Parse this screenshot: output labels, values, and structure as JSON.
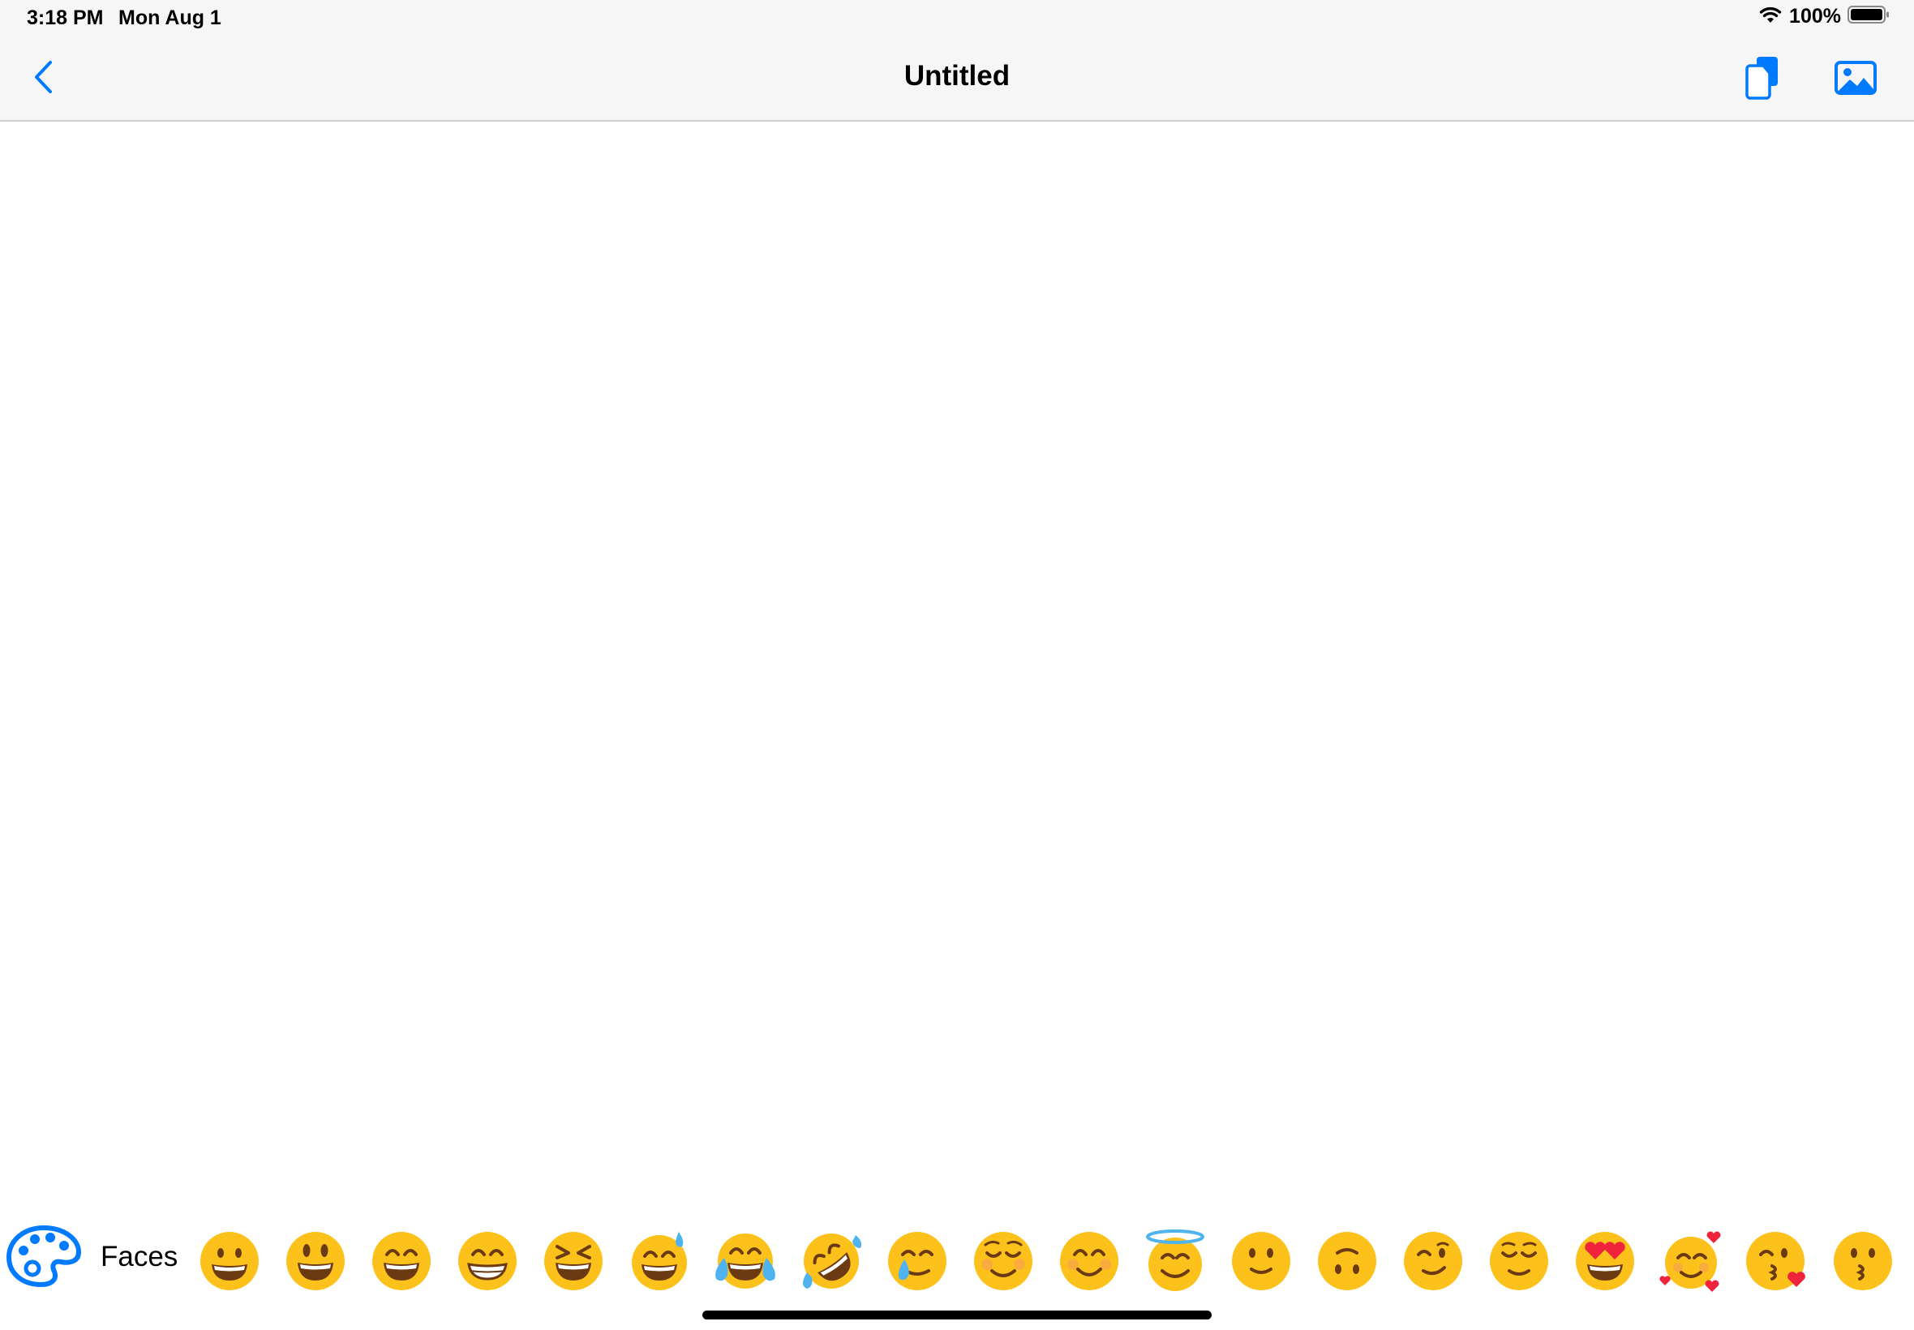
{
  "status_bar": {
    "time": "3:18 PM",
    "date": "Mon Aug 1",
    "battery_percent": "100%",
    "battery_level": 1.0,
    "icons": [
      "wifi-icon",
      "battery-icon"
    ]
  },
  "nav_bar": {
    "title": "Untitled",
    "back_icon": "chevron-left-icon",
    "actions": [
      {
        "name": "duplicate-button",
        "icon": "duplicate-pages-icon"
      },
      {
        "name": "insert-image-button",
        "icon": "photo-icon"
      }
    ]
  },
  "emoji_bar": {
    "palette_icon": "palette-icon",
    "category_label": "Faces",
    "emojis": [
      {
        "name": "grinning-face",
        "char": "😀"
      },
      {
        "name": "grinning-face-big-eyes",
        "char": "😃"
      },
      {
        "name": "grinning-face-smiling-eyes",
        "char": "😄"
      },
      {
        "name": "beaming-face",
        "char": "😁"
      },
      {
        "name": "squinting-face",
        "char": "😆"
      },
      {
        "name": "grinning-face-sweat",
        "char": "😅"
      },
      {
        "name": "tears-of-joy-face",
        "char": "😂"
      },
      {
        "name": "rolling-on-floor-laughing",
        "char": "🤣"
      },
      {
        "name": "holding-back-tears-face",
        "char": "🥲"
      },
      {
        "name": "smiling-face",
        "char": "☺️"
      },
      {
        "name": "smiling-face-smiling-eyes",
        "char": "😊"
      },
      {
        "name": "smiling-face-halo",
        "char": "😇"
      },
      {
        "name": "slightly-smiling-face",
        "char": "🙂"
      },
      {
        "name": "upside-down-face",
        "char": "🙃"
      },
      {
        "name": "winking-face",
        "char": "😉"
      },
      {
        "name": "relieved-face",
        "char": "😌"
      },
      {
        "name": "heart-eyes-face",
        "char": "😍"
      },
      {
        "name": "smiling-face-hearts",
        "char": "🥰"
      },
      {
        "name": "face-blowing-kiss",
        "char": "😘"
      },
      {
        "name": "kissing-face",
        "char": "😗"
      }
    ]
  },
  "colors": {
    "accent": "#007aff",
    "bar_background": "#f6f6f6",
    "emoji_yellow": "#fcc21b",
    "emoji_dark": "#6b3a12"
  }
}
